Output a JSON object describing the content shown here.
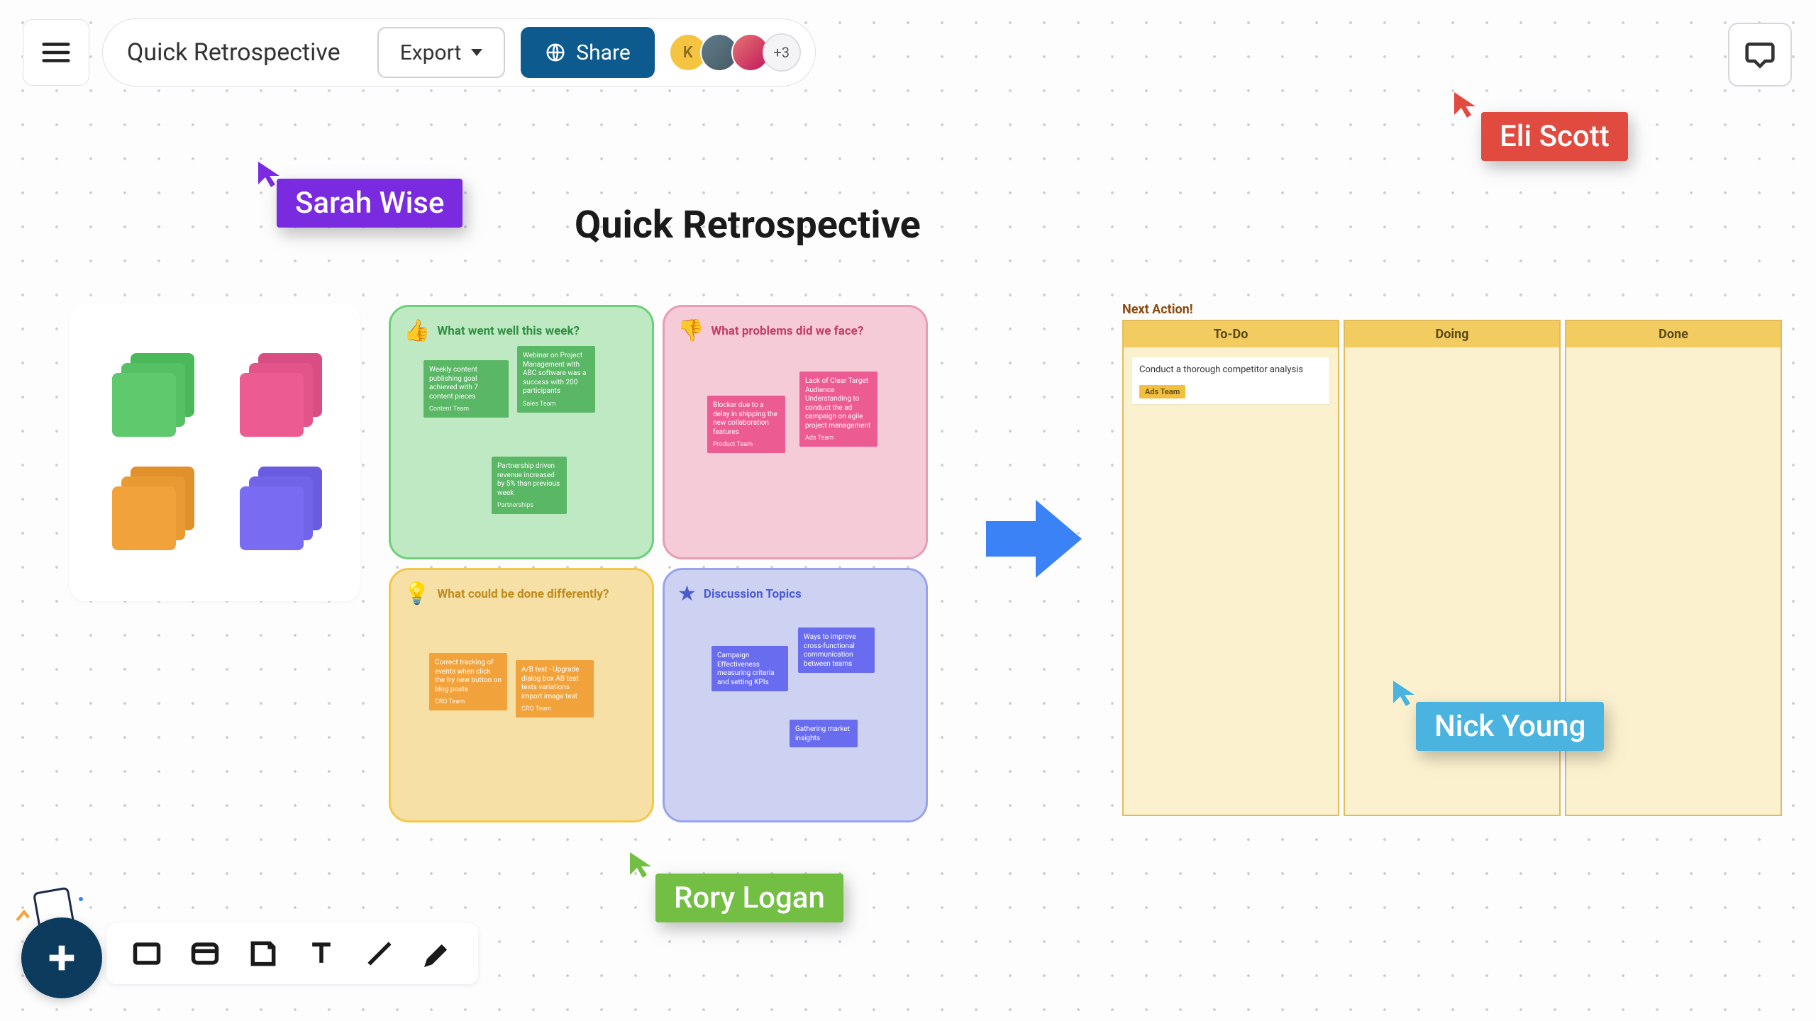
{
  "header": {
    "doc_title": "Quick Retrospective",
    "export_label": "Export",
    "share_label": "Share",
    "avatar_letter": "K",
    "avatar_more": "+3"
  },
  "canvas": {
    "title": "Quick Retrospective"
  },
  "cursors": {
    "sarah": "Sarah Wise",
    "eli": "Eli Scott",
    "rory": "Rory Logan",
    "nick": "Nick Young"
  },
  "quads": {
    "went_well": {
      "title": "What went well this week?",
      "notes": [
        {
          "text": "Weekly content publishing goal achieved with 7 content pieces",
          "team": "Content Team"
        },
        {
          "text": "Webinar on Project Management with ABC software was a success with 200 participants",
          "team": "Sales Team"
        },
        {
          "text": "Partnership driven revenue increased by 5% than previous week",
          "team": "Partnerships"
        }
      ]
    },
    "problems": {
      "title": "What problems did we face?",
      "notes": [
        {
          "text": "Blocker due to a delay in shipping the new collaboration features",
          "team": "Product Team"
        },
        {
          "text": "Lack of Clear Target Audience Understanding to conduct the ad campaign on agile project management",
          "team": "Ads Team"
        }
      ]
    },
    "improve": {
      "title": "What could be done differently?",
      "notes": [
        {
          "text": "Correct tracking of events when click the try new button on blog posts",
          "team": "CRO Team"
        },
        {
          "text": "A/B test - Upgrade dialog box AB test texts variations import image test",
          "team": "CRO Team"
        }
      ]
    },
    "discussion": {
      "title": "Discussion Topics",
      "notes": [
        {
          "text": "Campaign Effectiveness measuring criteria and setting KPIs",
          "team": ""
        },
        {
          "text": "Ways to improve cross-functional communication between teams",
          "team": ""
        },
        {
          "text": "Gathering market insights",
          "team": ""
        }
      ]
    }
  },
  "kanban": {
    "title": "Next Action!",
    "columns": [
      "To-Do",
      "Doing",
      "Done"
    ],
    "card": {
      "text": "Conduct a thorough competitor analysis",
      "tag": "Ads Team"
    }
  }
}
